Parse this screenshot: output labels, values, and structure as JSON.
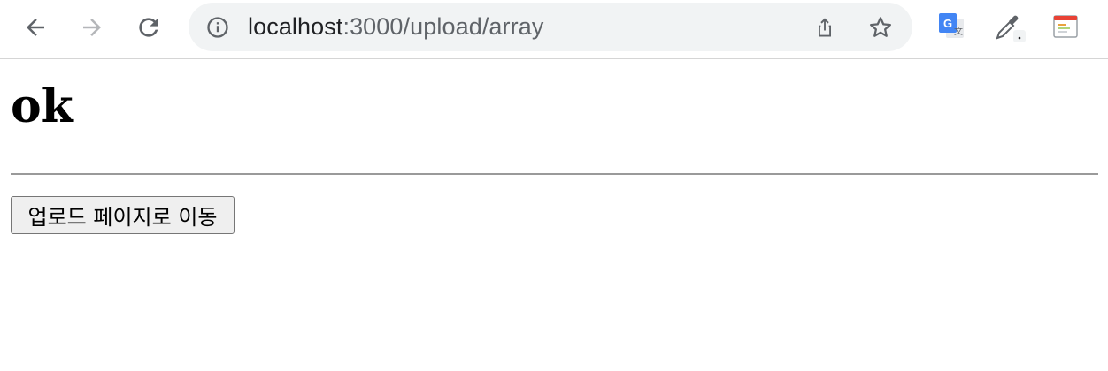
{
  "browser": {
    "url_host": "localhost",
    "url_path": ":3000/upload/array",
    "icons": {
      "back": "back-arrow-icon",
      "forward": "forward-arrow-icon",
      "reload": "reload-icon",
      "site_info": "info-icon",
      "share": "share-icon",
      "bookmark": "star-icon",
      "translate": "google-translate-icon",
      "eyedropper": "eyedropper-icon",
      "extension": "extension-icon"
    }
  },
  "page": {
    "heading": "ok",
    "button_label": "업로드 페이지로 이동"
  },
  "colors": {
    "omnibox_bg": "#f1f3f4",
    "icon": "#5f6368",
    "icon_disabled": "#b4b6b9",
    "translate_blue": "#4285f4"
  }
}
